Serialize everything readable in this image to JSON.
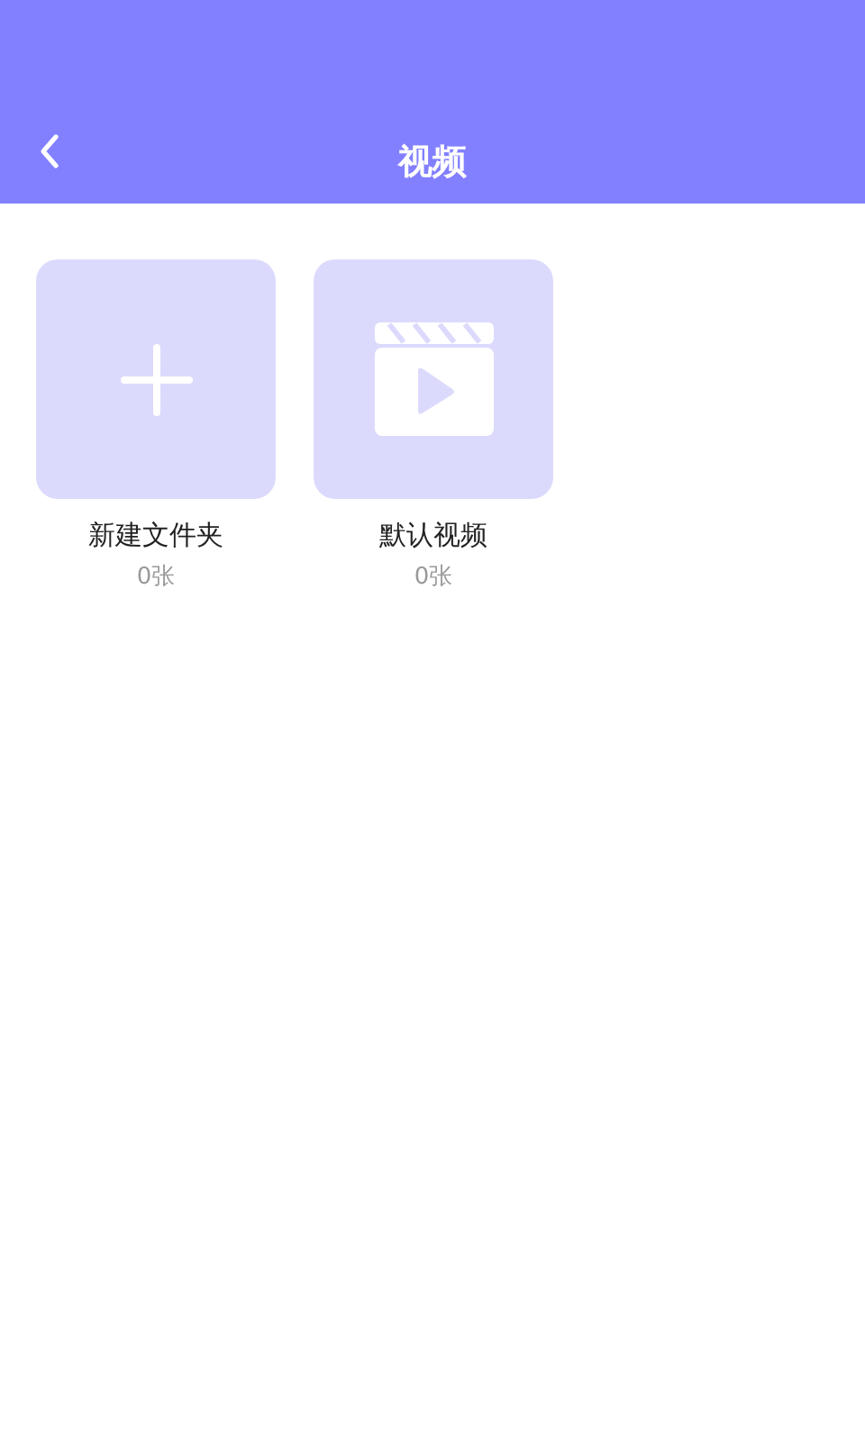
{
  "header": {
    "title": "视频"
  },
  "folders": [
    {
      "kind": "add",
      "name": "新建文件夹",
      "count": "0张"
    },
    {
      "kind": "video",
      "name": "默认视频",
      "count": "0张"
    }
  ]
}
